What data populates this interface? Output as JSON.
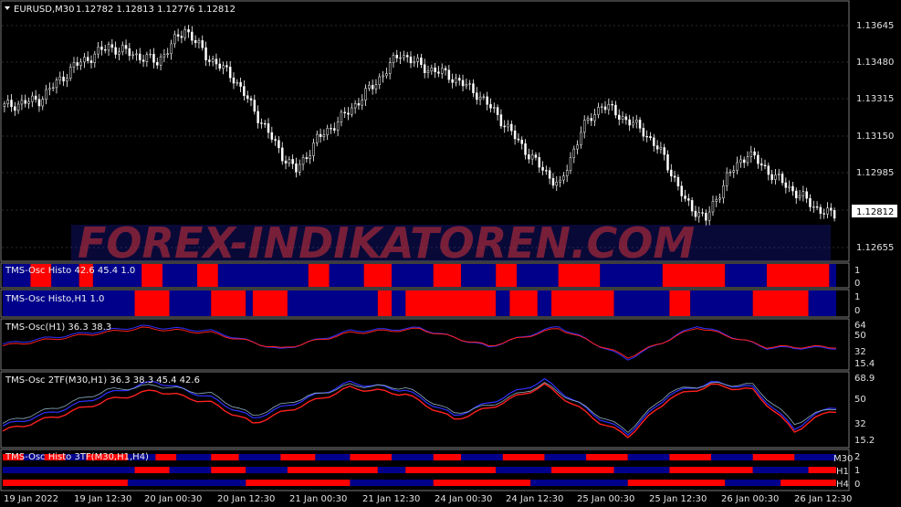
{
  "watermark": "FOREX-INDIKATOREN.COM",
  "main": {
    "header_title": "EURUSD,M30",
    "header_ohlc": "1.12782 1.12813 1.12776 1.12812",
    "price_ticks": [
      "1.13645",
      "1.13480",
      "1.13315",
      "1.13150",
      "1.12985",
      "1.12655"
    ],
    "current_price": "1.12812"
  },
  "panes": {
    "histo": {
      "label": "TMS-Osc Histo 42.6 45.4 1.0",
      "ticks": [
        "1",
        "0"
      ]
    },
    "histo_h1": {
      "label": "TMS-Osc Histo,H1 1.0",
      "ticks": [
        "1",
        "0"
      ]
    },
    "osc_h1": {
      "label": "TMS-Osc(H1) 36.3 38.3",
      "ticks": [
        "64",
        "50",
        "32",
        "15.4"
      ]
    },
    "osc_2tf": {
      "label": "TMS-Osc 2TF(M30,H1) 36.3 38.3 45.4 42.6",
      "ticks": [
        "68.9",
        "50",
        "32",
        "15.2"
      ]
    },
    "histo_3tf": {
      "label": "TMS-Osc Histo 3TF(M30,H1,H4)",
      "ticks": [
        "2",
        "1",
        "0"
      ],
      "rows": [
        "M30",
        "H1",
        "H4"
      ]
    }
  },
  "time_axis": [
    "19 Jan 2022",
    "19 Jan 12:30",
    "20 Jan 00:30",
    "20 Jan 12:30",
    "21 Jan 00:30",
    "21 Jan 12:30",
    "24 Jan 00:30",
    "24 Jan 12:30",
    "25 Jan 00:30",
    "25 Jan 12:30",
    "26 Jan 00:30",
    "26 Jan 12:30"
  ],
  "colors": {
    "bull": "#ff0000",
    "bear": "#00008b",
    "candle": "#ffffff",
    "grid": "#5a5a5a",
    "osc_fast": "#3030ff",
    "osc_slow": "#ff2020"
  },
  "chart_data": {
    "type": "candlestick",
    "symbol": "EURUSD,M30",
    "ylim": [
      1.126,
      1.1372
    ],
    "close_path": [
      [
        0,
        1.1329
      ],
      [
        5,
        1.1332
      ],
      [
        10,
        1.1347
      ],
      [
        15,
        1.1356
      ],
      [
        19,
        1.1352
      ],
      [
        22,
        1.1349
      ],
      [
        26,
        1.1364
      ],
      [
        29,
        1.1352
      ],
      [
        33,
        1.1342
      ],
      [
        37,
        1.1322
      ],
      [
        40,
        1.1307
      ],
      [
        42,
        1.13
      ],
      [
        45,
        1.1314
      ],
      [
        49,
        1.1325
      ],
      [
        53,
        1.1338
      ],
      [
        57,
        1.1353
      ],
      [
        60,
        1.1347
      ],
      [
        64,
        1.1343
      ],
      [
        68,
        1.1335
      ],
      [
        71,
        1.1325
      ],
      [
        74,
        1.1313
      ],
      [
        77,
        1.1302
      ],
      [
        80,
        1.1293
      ],
      [
        83,
        1.1318
      ],
      [
        86,
        1.133
      ],
      [
        89,
        1.1324
      ],
      [
        92,
        1.1318
      ],
      [
        95,
        1.1306
      ],
      [
        98,
        1.1286
      ],
      [
        101,
        1.1278
      ],
      [
        104,
        1.1297
      ],
      [
        107,
        1.1308
      ],
      [
        111,
        1.1297
      ],
      [
        114,
        1.129
      ],
      [
        117,
        1.1283
      ],
      [
        119,
        1.128
      ]
    ],
    "histo_segments": [
      [
        0,
        4,
        "bear"
      ],
      [
        4,
        7,
        "bull"
      ],
      [
        7,
        11,
        "bear"
      ],
      [
        11,
        13,
        "bull"
      ],
      [
        13,
        20,
        "bear"
      ],
      [
        20,
        23,
        "bull"
      ],
      [
        23,
        28,
        "bear"
      ],
      [
        28,
        31,
        "bull"
      ],
      [
        31,
        44,
        "bear"
      ],
      [
        44,
        47,
        "bull"
      ],
      [
        47,
        52,
        "bear"
      ],
      [
        52,
        56,
        "bull"
      ],
      [
        56,
        62,
        "bear"
      ],
      [
        62,
        66,
        "bull"
      ],
      [
        66,
        71,
        "bear"
      ],
      [
        71,
        74,
        "bull"
      ],
      [
        74,
        80,
        "bear"
      ],
      [
        80,
        86,
        "bull"
      ],
      [
        86,
        95,
        "bear"
      ],
      [
        95,
        104,
        "bull"
      ],
      [
        104,
        110,
        "bear"
      ],
      [
        110,
        119,
        "bull"
      ],
      [
        119,
        120,
        "bear"
      ]
    ],
    "histo_h1_segments": [
      [
        0,
        19,
        "bear"
      ],
      [
        19,
        24,
        "bull"
      ],
      [
        24,
        30,
        "bear"
      ],
      [
        30,
        35,
        "bull"
      ],
      [
        35,
        36,
        "bear"
      ],
      [
        36,
        41,
        "bull"
      ],
      [
        41,
        54,
        "bear"
      ],
      [
        54,
        56,
        "bull"
      ],
      [
        56,
        58,
        "bear"
      ],
      [
        58,
        71,
        "bull"
      ],
      [
        71,
        73,
        "bear"
      ],
      [
        73,
        77,
        "bull"
      ],
      [
        77,
        79,
        "bear"
      ],
      [
        79,
        88,
        "bull"
      ],
      [
        88,
        96,
        "bear"
      ],
      [
        96,
        99,
        "bull"
      ],
      [
        99,
        108,
        "bear"
      ],
      [
        108,
        116,
        "bull"
      ],
      [
        116,
        120,
        "bear"
      ]
    ],
    "osc_h1_fast": [
      [
        0,
        40
      ],
      [
        10,
        50
      ],
      [
        20,
        59
      ],
      [
        30,
        54
      ],
      [
        40,
        34
      ],
      [
        50,
        54
      ],
      [
        60,
        57
      ],
      [
        70,
        37
      ],
      [
        80,
        59
      ],
      [
        90,
        24
      ],
      [
        100,
        60
      ],
      [
        110,
        36
      ],
      [
        119,
        36
      ]
    ],
    "osc_h1_slow": [
      [
        0,
        38
      ],
      [
        10,
        48
      ],
      [
        20,
        57
      ],
      [
        30,
        52
      ],
      [
        40,
        35
      ],
      [
        50,
        52
      ],
      [
        60,
        56
      ],
      [
        70,
        38
      ],
      [
        80,
        57
      ],
      [
        90,
        26
      ],
      [
        100,
        58
      ],
      [
        110,
        37
      ],
      [
        119,
        37
      ]
    ],
    "osc_2tf_a": [
      [
        0,
        30
      ],
      [
        8,
        42
      ],
      [
        15,
        55
      ],
      [
        22,
        65
      ],
      [
        30,
        52
      ],
      [
        36,
        36
      ],
      [
        42,
        48
      ],
      [
        50,
        64
      ],
      [
        58,
        58
      ],
      [
        65,
        38
      ],
      [
        70,
        48
      ],
      [
        78,
        66
      ],
      [
        86,
        36
      ],
      [
        90,
        24
      ],
      [
        96,
        55
      ],
      [
        102,
        64
      ],
      [
        108,
        60
      ],
      [
        114,
        28
      ],
      [
        119,
        45
      ]
    ],
    "osc_2tf_b": [
      [
        0,
        26
      ],
      [
        8,
        38
      ],
      [
        15,
        50
      ],
      [
        22,
        58
      ],
      [
        30,
        48
      ],
      [
        36,
        32
      ],
      [
        42,
        44
      ],
      [
        50,
        60
      ],
      [
        58,
        55
      ],
      [
        65,
        35
      ],
      [
        70,
        44
      ],
      [
        78,
        62
      ],
      [
        86,
        33
      ],
      [
        90,
        22
      ],
      [
        96,
        52
      ],
      [
        102,
        62
      ],
      [
        108,
        58
      ],
      [
        114,
        26
      ],
      [
        119,
        42
      ]
    ],
    "osc_2tf_c": [
      [
        0,
        32
      ],
      [
        8,
        45
      ],
      [
        15,
        58
      ],
      [
        22,
        62
      ],
      [
        30,
        55
      ],
      [
        36,
        38
      ],
      [
        42,
        50
      ],
      [
        50,
        62
      ],
      [
        58,
        60
      ],
      [
        65,
        40
      ],
      [
        70,
        46
      ],
      [
        78,
        63
      ],
      [
        86,
        38
      ],
      [
        90,
        26
      ],
      [
        96,
        57
      ],
      [
        102,
        63
      ],
      [
        108,
        62
      ],
      [
        114,
        32
      ],
      [
        119,
        44
      ]
    ],
    "histo_3tf_rows": [
      [
        [
          0,
          3,
          "bull"
        ],
        [
          3,
          6,
          "bear"
        ],
        [
          6,
          9,
          "bull"
        ],
        [
          9,
          12,
          "bear"
        ],
        [
          12,
          18,
          "bull"
        ],
        [
          18,
          22,
          "bear"
        ],
        [
          22,
          25,
          "bull"
        ],
        [
          25,
          30,
          "bear"
        ],
        [
          30,
          34,
          "bull"
        ],
        [
          34,
          40,
          "bear"
        ],
        [
          40,
          45,
          "bull"
        ],
        [
          45,
          50,
          "bear"
        ],
        [
          50,
          56,
          "bull"
        ],
        [
          56,
          62,
          "bear"
        ],
        [
          62,
          66,
          "bull"
        ],
        [
          66,
          72,
          "bear"
        ],
        [
          72,
          78,
          "bull"
        ],
        [
          78,
          84,
          "bear"
        ],
        [
          84,
          90,
          "bull"
        ],
        [
          90,
          96,
          "bear"
        ],
        [
          96,
          102,
          "bull"
        ],
        [
          102,
          108,
          "bear"
        ],
        [
          108,
          114,
          "bull"
        ],
        [
          114,
          120,
          "bear"
        ]
      ],
      [
        [
          0,
          19,
          "bear"
        ],
        [
          19,
          24,
          "bull"
        ],
        [
          24,
          30,
          "bear"
        ],
        [
          30,
          35,
          "bull"
        ],
        [
          35,
          41,
          "bear"
        ],
        [
          41,
          54,
          "bull"
        ],
        [
          54,
          58,
          "bear"
        ],
        [
          58,
          71,
          "bull"
        ],
        [
          71,
          79,
          "bear"
        ],
        [
          79,
          88,
          "bull"
        ],
        [
          88,
          96,
          "bear"
        ],
        [
          96,
          108,
          "bull"
        ],
        [
          108,
          116,
          "bear"
        ],
        [
          116,
          120,
          "bull"
        ]
      ],
      [
        [
          0,
          18,
          "bull"
        ],
        [
          18,
          35,
          "bear"
        ],
        [
          35,
          50,
          "bull"
        ],
        [
          50,
          62,
          "bear"
        ],
        [
          62,
          76,
          "bull"
        ],
        [
          76,
          90,
          "bear"
        ],
        [
          90,
          104,
          "bull"
        ],
        [
          104,
          112,
          "bear"
        ],
        [
          112,
          120,
          "bull"
        ]
      ]
    ]
  }
}
